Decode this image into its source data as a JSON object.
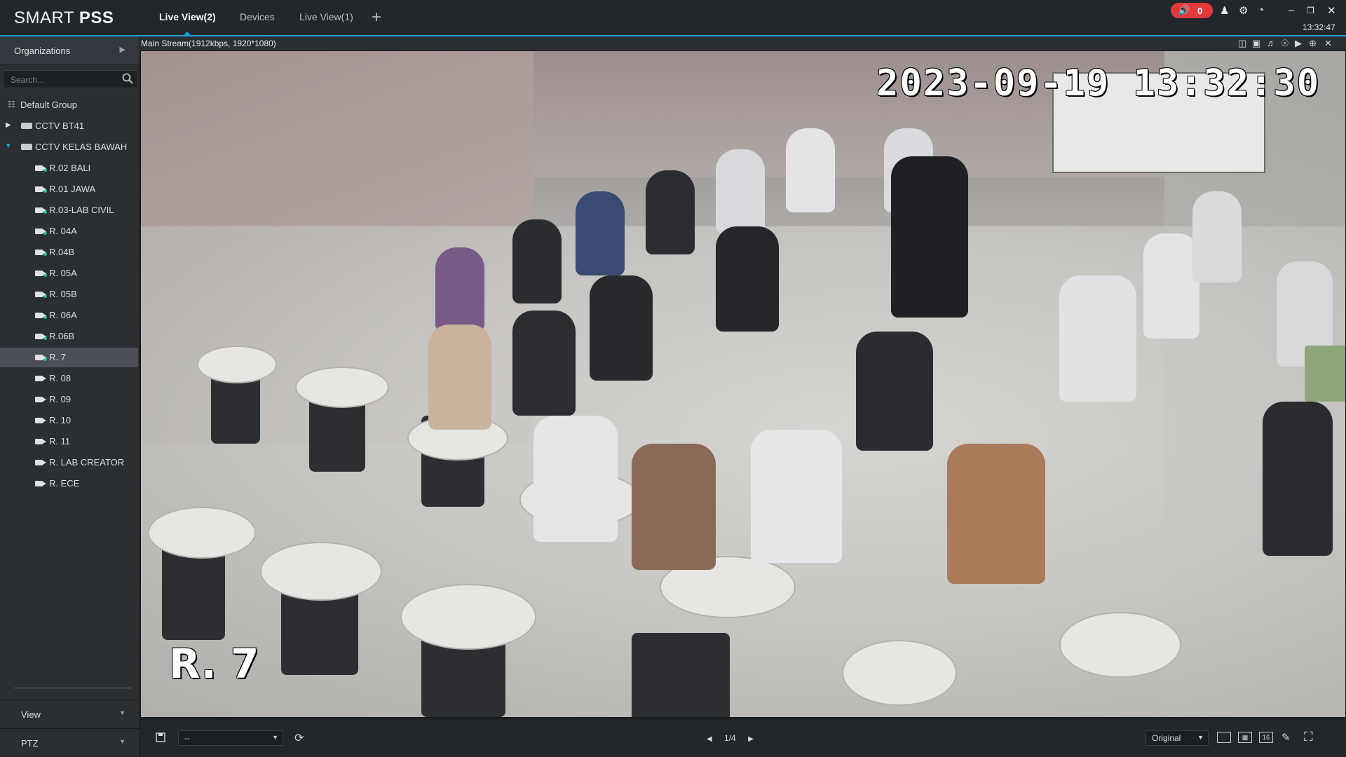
{
  "app": {
    "brand_regular": "SMART ",
    "brand_bold": "PSS",
    "clock": "13:32:47",
    "alarm_count": "0"
  },
  "tabs": [
    {
      "label": "Live View(2)",
      "active": true
    },
    {
      "label": "Devices",
      "active": false
    },
    {
      "label": "Live View(1)",
      "active": false
    }
  ],
  "titlebar_icons": [
    "speaker-icon",
    "user-icon",
    "settings-gear-icon",
    "performance-gauge-icon",
    "minimize-icon",
    "restore-icon",
    "close-icon"
  ],
  "sidebar": {
    "organizations_label": "Organizations",
    "search_placeholder": "Search...",
    "tree": {
      "root": "Default Group",
      "groups": [
        {
          "label": "CCTV BT41",
          "expanded": false
        },
        {
          "label": "CCTV KELAS BAWAH",
          "expanded": true
        }
      ],
      "channels": [
        {
          "label": "R.02 BALI",
          "online": true
        },
        {
          "label": "R.01 JAWA",
          "online": true
        },
        {
          "label": "R.03-LAB CIVIL",
          "online": true
        },
        {
          "label": "R. 04A",
          "online": true
        },
        {
          "label": "R.04B",
          "online": true
        },
        {
          "label": "R. 05A",
          "online": true
        },
        {
          "label": "R. 05B",
          "online": true
        },
        {
          "label": "R. 06A",
          "online": true
        },
        {
          "label": "R.06B",
          "online": true
        },
        {
          "label": "R. 7",
          "online": true,
          "selected": true
        },
        {
          "label": "R. 08",
          "online": false
        },
        {
          "label": "R. 09",
          "online": false
        },
        {
          "label": "R. 10",
          "online": false
        },
        {
          "label": "R. 11",
          "online": false
        },
        {
          "label": "R. LAB CREATOR",
          "online": false
        },
        {
          "label": "R. ECE",
          "online": false
        }
      ]
    },
    "view_label": "View",
    "ptz_label": "PTZ"
  },
  "video": {
    "stream_info": "Main Stream(1912kbps, 1920*1080)",
    "timestamp_osd": "2023-09-19  13:32:30",
    "channel_osd": "R. 7"
  },
  "bottombar": {
    "preset_value": "--",
    "page_indicator": "1/4",
    "ratio_value": "Original",
    "layout_16_label": "16"
  },
  "colors": {
    "accent": "#1aa0d8",
    "alarm": "#e23a3a",
    "online": "#2ec27e"
  }
}
